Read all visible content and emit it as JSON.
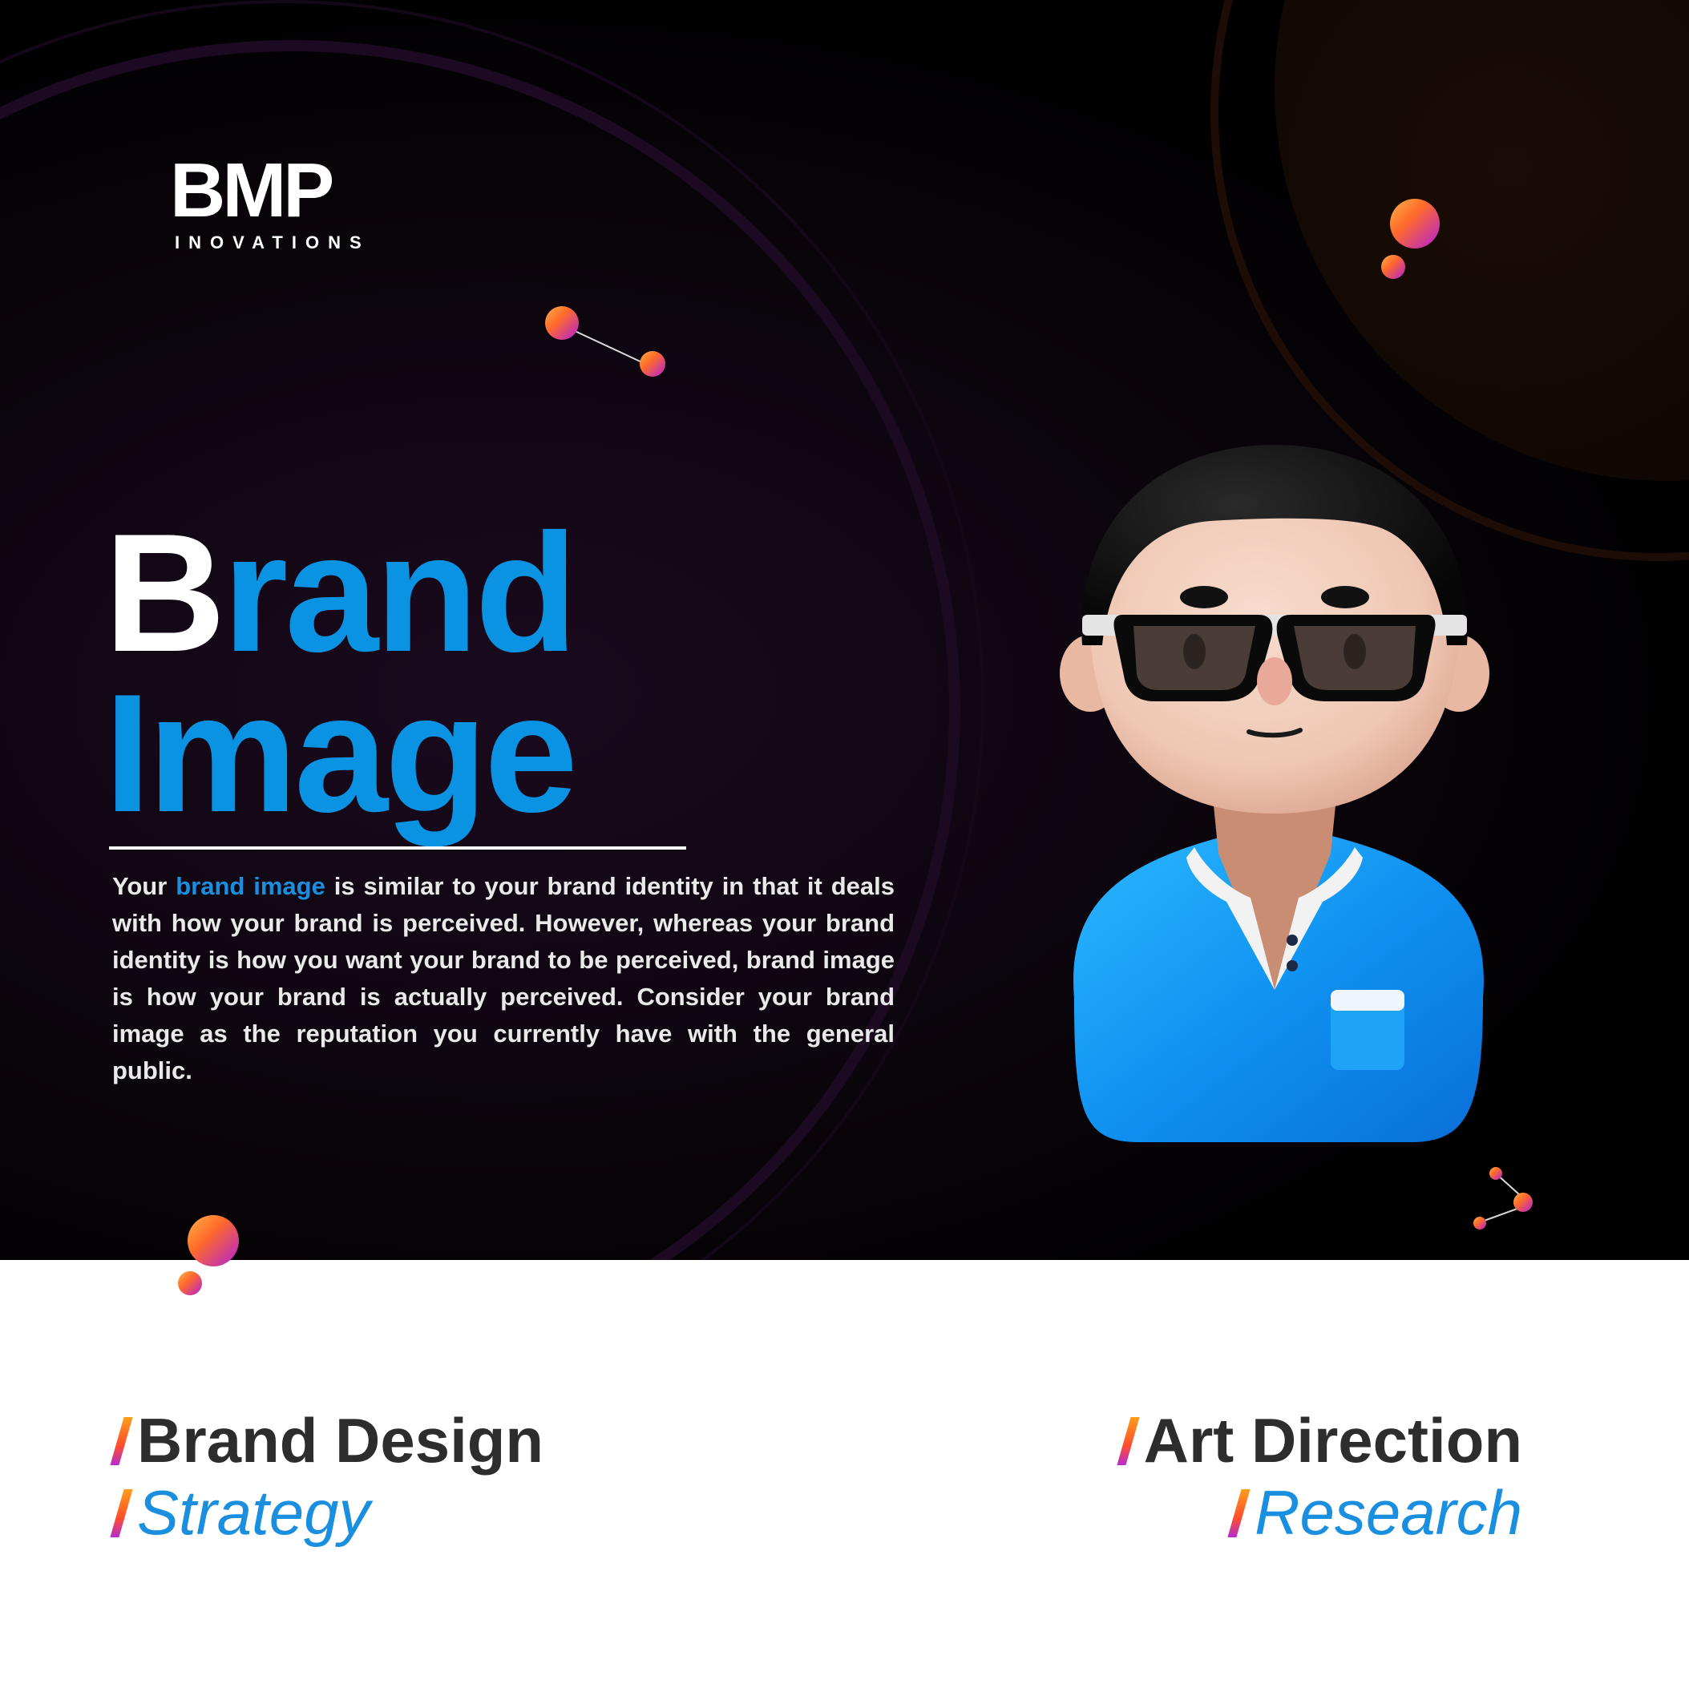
{
  "brand": {
    "logo_mark": "BMP",
    "logo_sub": "INOVATIONS"
  },
  "headline": {
    "first_letter": "B",
    "line1_rest": "rand",
    "line2": "Image"
  },
  "body": {
    "before": "Your ",
    "highlight": "brand image",
    "after": " is similar to your brand identity in that it deals with how your brand is perceived. However, whereas your brand identity is how you want your brand to be perceived, brand image is how your brand is actually perceived. Consider your brand image as the reputation you currently have with the general public."
  },
  "services": {
    "left_main": "Brand Design",
    "left_sub": "Strategy",
    "right_main": "Art Direction",
    "right_sub": "Research"
  },
  "colors": {
    "accent_blue": "#0b93e3",
    "dark_bg": "#000000",
    "text_dark": "#2d2d2d",
    "gradient": [
      "#ffb347",
      "#ff6a2b",
      "#b21fd6"
    ]
  },
  "illustration": {
    "icon": "avatar-man-sunglasses-icon"
  }
}
